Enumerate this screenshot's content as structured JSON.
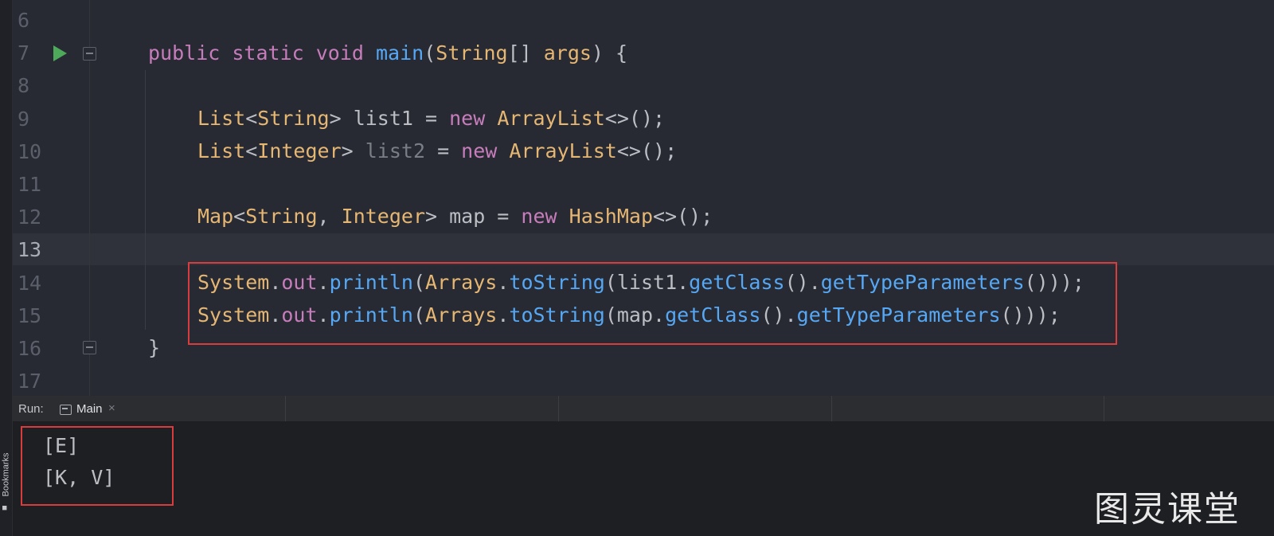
{
  "editor": {
    "line_numbers": [
      "6",
      "7",
      "8",
      "9",
      "10",
      "11",
      "12",
      "13",
      "14",
      "15",
      "16",
      "17"
    ],
    "lines": {
      "l7": [
        [
          "kw",
          "public "
        ],
        [
          "kw",
          "static "
        ],
        [
          "kw",
          "void "
        ],
        [
          "fn",
          "main"
        ],
        [
          "",
          "("
        ],
        [
          "ty",
          "String"
        ],
        [
          "",
          "[] "
        ],
        [
          "ty",
          "args"
        ],
        [
          "",
          ") {"
        ]
      ],
      "l9": [
        [
          "ty",
          "List"
        ],
        [
          "",
          "<"
        ],
        [
          "ty",
          "String"
        ],
        [
          "",
          "> list1 = "
        ],
        [
          "kw",
          "new "
        ],
        [
          "ty",
          "ArrayList"
        ],
        [
          "",
          "<>();"
        ]
      ],
      "l10": [
        [
          "ty",
          "List"
        ],
        [
          "",
          "<"
        ],
        [
          "ty",
          "Integer"
        ],
        [
          "",
          "> "
        ],
        [
          "muted",
          "list2"
        ],
        [
          "",
          " = "
        ],
        [
          "kw",
          "new "
        ],
        [
          "ty",
          "ArrayList"
        ],
        [
          "",
          "<>();"
        ]
      ],
      "l12": [
        [
          "ty",
          "Map"
        ],
        [
          "",
          "<"
        ],
        [
          "ty",
          "String"
        ],
        [
          "",
          ", "
        ],
        [
          "ty",
          "Integer"
        ],
        [
          "",
          "> map = "
        ],
        [
          "kw",
          "new "
        ],
        [
          "ty",
          "HashMap"
        ],
        [
          "",
          "<>();"
        ]
      ],
      "l14": [
        [
          "ty",
          "System"
        ],
        [
          "",
          "."
        ],
        [
          "fld",
          "out"
        ],
        [
          "",
          "."
        ],
        [
          "fn",
          "println"
        ],
        [
          "",
          "("
        ],
        [
          "ty",
          "Arrays"
        ],
        [
          "",
          "."
        ],
        [
          "fn",
          "toString"
        ],
        [
          "",
          "(list1."
        ],
        [
          "fn",
          "getClass"
        ],
        [
          "",
          "()."
        ],
        [
          "fn",
          "getTypeParameters"
        ],
        [
          "",
          "()));"
        ]
      ],
      "l15": [
        [
          "ty",
          "System"
        ],
        [
          "",
          "."
        ],
        [
          "fld",
          "out"
        ],
        [
          "",
          "."
        ],
        [
          "fn",
          "println"
        ],
        [
          "",
          "("
        ],
        [
          "ty",
          "Arrays"
        ],
        [
          "",
          "."
        ],
        [
          "fn",
          "toString"
        ],
        [
          "",
          "(map."
        ],
        [
          "fn",
          "getClass"
        ],
        [
          "",
          "()."
        ],
        [
          "fn",
          "getTypeParameters"
        ],
        [
          "",
          "()));"
        ]
      ],
      "l16": [
        [
          "",
          "}"
        ]
      ]
    }
  },
  "run_panel": {
    "label": "Run:",
    "tab_label": "Main",
    "tab_close": "×"
  },
  "console": {
    "output": [
      "[E]",
      "[K, V]"
    ]
  },
  "sidebar": {
    "bookmarks_label": "Bookmarks"
  },
  "watermark": "图灵课堂",
  "colors": {
    "keyword": "#c77dbb",
    "type": "#e6b673",
    "function": "#56a8f5",
    "highlight_box": "#d93c3c",
    "run_icon": "#4eaa5b"
  }
}
